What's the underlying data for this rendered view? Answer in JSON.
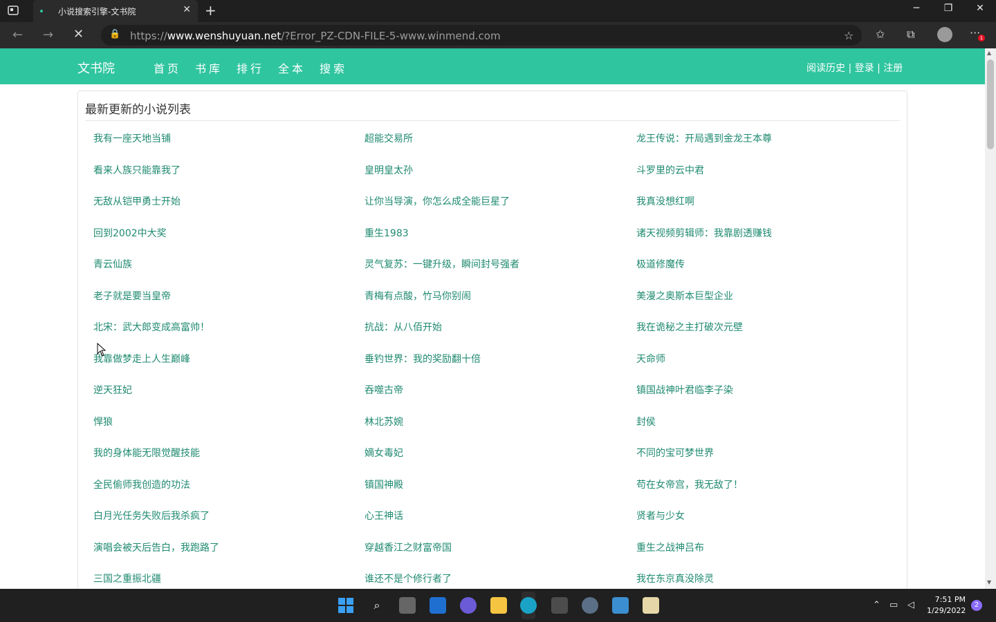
{
  "browser": {
    "tab_title": "小说搜索引擎-文书院",
    "url_scheme": "https://",
    "url_host": "www.wenshuyuan.net",
    "url_path": "/?Error_PZ-CDN-FILE-5-www.winmend.com",
    "notification_count": "1"
  },
  "site": {
    "logo": "文书院",
    "nav": [
      "首页",
      "书库",
      "排行",
      "全本",
      "搜索"
    ],
    "user_links": "阅读历史 | 登录 | 注册",
    "panel_title": "最新更新的小说列表",
    "novels": [
      [
        "我有一座天地当铺",
        "超能交易所",
        "龙王传说：开局遇到金龙王本尊"
      ],
      [
        "看来人族只能靠我了",
        "皇明皇太孙",
        "斗罗里的云中君"
      ],
      [
        "无敌从铠甲勇士开始",
        "让你当导演，你怎么成全能巨星了",
        "我真没想红啊"
      ],
      [
        "回到2002中大奖",
        "重生1983",
        "诸天视频剪辑师：我靠剧透赚钱"
      ],
      [
        "青云仙族",
        "灵气复苏：一键升级，瞬间封号强者",
        "极道修魔传"
      ],
      [
        "老子就是要当皇帝",
        "青梅有点酸，竹马你别闹",
        "美漫之奥斯本巨型企业"
      ],
      [
        "北宋：武大郎变成高富帅！",
        "抗战：从八佰开始",
        "我在诡秘之主打破次元壁"
      ],
      [
        "我靠做梦走上人生巅峰",
        "垂钓世界：我的奖励翻十倍",
        "天命师"
      ],
      [
        "逆天狂妃",
        "吞噬古帝",
        "镇国战神叶君临李子染"
      ],
      [
        "悍狼",
        "林北苏婉",
        "封侯"
      ],
      [
        "我的身体能无限觉醒技能",
        "嫡女毒妃",
        "不同的宝可梦世界"
      ],
      [
        "全民偷师我创造的功法",
        "镇国神殿",
        "苟在女帝宫，我无敌了！"
      ],
      [
        "白月光任务失败后我杀疯了",
        "心王神话",
        "贤者与少女"
      ],
      [
        "演唱会被天后告白，我跑路了",
        "穿越香江之财富帝国",
        "重生之战神吕布"
      ],
      [
        "三国之重振北疆",
        "谁还不是个修行者了",
        "我在东京真没除灵"
      ]
    ]
  },
  "taskbar": {
    "time": "7:51 PM",
    "date": "1/29/2022",
    "notification_count": "2"
  },
  "colors": {
    "site_green": "#2fc59f",
    "link_green": "#1f8a70",
    "chrome_dark": "#1f1f1f"
  }
}
